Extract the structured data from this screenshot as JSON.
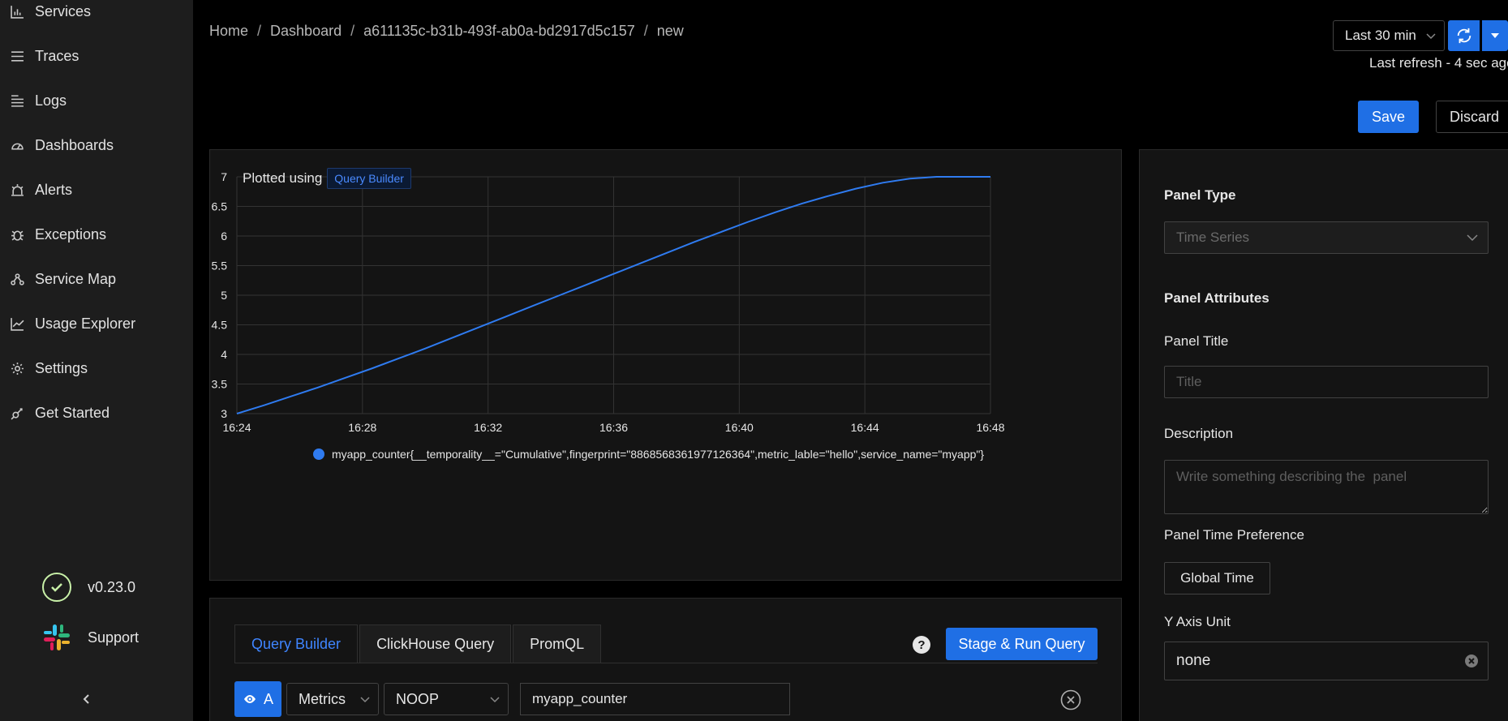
{
  "sidebar": {
    "items": [
      {
        "label": "Services",
        "icon": "bar-chart-icon"
      },
      {
        "label": "Traces",
        "icon": "menu-lines-icon"
      },
      {
        "label": "Logs",
        "icon": "logs-icon"
      },
      {
        "label": "Dashboards",
        "icon": "dashboard-gauge-icon"
      },
      {
        "label": "Alerts",
        "icon": "alarm-icon"
      },
      {
        "label": "Exceptions",
        "icon": "bug-icon"
      },
      {
        "label": "Service Map",
        "icon": "deployment-unit-icon"
      },
      {
        "label": "Usage Explorer",
        "icon": "line-chart-icon"
      },
      {
        "label": "Settings",
        "icon": "gear-icon"
      },
      {
        "label": "Get Started",
        "icon": "api-icon"
      }
    ],
    "version": "v0.23.0",
    "support": "Support"
  },
  "breadcrumb": [
    "Home",
    "Dashboard",
    "a611135c-b31b-493f-ab0a-bd2917d5c157",
    "new"
  ],
  "header": {
    "time_range": "Last 30 min",
    "last_refresh": "Last refresh - 4 sec ago",
    "save_label": "Save",
    "discard_label": "Discard"
  },
  "chart_panel": {
    "plotted_using": "Plotted using",
    "builder_tag": "Query Builder"
  },
  "chart_data": {
    "type": "line",
    "title": "",
    "xlabel": "",
    "ylabel": "",
    "x": [
      "16:24",
      "16:25",
      "16:26",
      "16:27",
      "16:28",
      "16:29",
      "16:30",
      "16:31",
      "16:32",
      "16:33",
      "16:34",
      "16:35",
      "16:36",
      "16:37",
      "16:38",
      "16:39",
      "16:40",
      "16:41",
      "16:42",
      "16:43",
      "16:44",
      "16:45",
      "16:46",
      "16:47",
      "16:48"
    ],
    "x_ticks": [
      "16:24",
      "16:28",
      "16:32",
      "16:36",
      "16:40",
      "16:44",
      "16:48"
    ],
    "y_ticks": [
      3,
      3.5,
      4,
      4.5,
      5,
      5.5,
      6,
      6.5,
      7
    ],
    "ylim": [
      3,
      7
    ],
    "grid": true,
    "legend_position": "bottom",
    "series": [
      {
        "name": "myapp_counter{__temporality__=\"Cumulative\",fingerprint=\"8868568361977126364\",metric_lable=\"hello\",service_name=\"myapp\"}",
        "color": "#2f7bf0",
        "values": [
          3.0,
          3.14,
          3.29,
          3.44,
          3.6,
          3.76,
          3.93,
          4.1,
          4.28,
          4.46,
          4.64,
          4.82,
          5.0,
          5.18,
          5.36,
          5.54,
          5.72,
          5.9,
          6.07,
          6.24,
          6.4,
          6.55,
          6.68,
          6.8,
          6.9,
          6.97,
          7.0,
          7.0,
          7.0
        ]
      }
    ]
  },
  "query": {
    "tabs": [
      "Query Builder",
      "ClickHouse Query",
      "PromQL"
    ],
    "help": "?",
    "run_label": "Stage & Run Query",
    "query_name": "A",
    "data_source": "Metrics",
    "aggregation": "NOOP",
    "metric_name": "myapp_counter"
  },
  "right_panel": {
    "panel_type_heading": "Panel Type",
    "panel_type_value": "Time Series",
    "attributes_heading": "Panel Attributes",
    "title_label": "Panel Title",
    "title_placeholder": "Title",
    "description_label": "Description",
    "description_placeholder": "Write something describing the  panel",
    "time_pref_label": "Panel Time Preference",
    "time_pref_value": "Global Time",
    "y_axis_label": "Y Axis Unit",
    "y_axis_value": "none"
  },
  "colors": {
    "accent": "#1f6fe5",
    "sidebar_bg": "#1d1d1d",
    "panel_bg": "#141414",
    "line": "#2f7bf0"
  }
}
